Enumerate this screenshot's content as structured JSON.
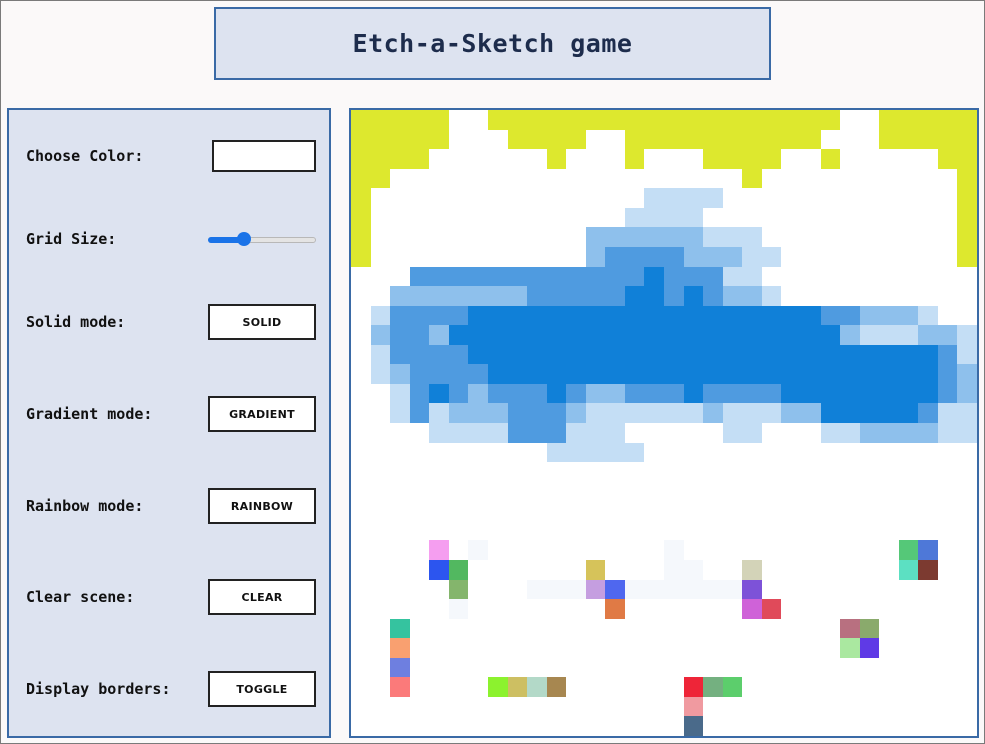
{
  "title": "Etch-a-Sketch game",
  "controls": {
    "choose_color_label": "Choose Color:",
    "current_color": "#ffffff",
    "grid_size_label": "Grid Size:",
    "grid_size_value": 32,
    "grid_size_min": 1,
    "grid_size_max": 100,
    "solid_label": "Solid mode:",
    "solid_button": "SOLID",
    "gradient_label": "Gradient mode:",
    "gradient_button": "GRADIENT",
    "rainbow_label": "Rainbow mode:",
    "rainbow_button": "RAINBOW",
    "clear_label": "Clear scene:",
    "clear_button": "CLEAR",
    "borders_label": "Display borders:",
    "borders_button": "TOGGLE"
  },
  "colors": {
    "panel_bg": "#dde3f0",
    "panel_border": "#3a6aa6",
    "slider_accent": "#1a73e8",
    "yellow": "#dde82e",
    "blue_dark": "#1080d8",
    "blue_mid": "#4f9be0",
    "blue_light": "#8ec0ec",
    "blue_pale": "#c4def5"
  },
  "grid": {
    "size": 32,
    "palette": {
      "Y": "#dde82e",
      "D": "#1080d8",
      "M": "#4f9be0",
      "L": "#8ec0ec",
      "P": "#c4def5",
      "F": "#f5f8fc"
    },
    "rows": [
      "YYYYY..YYYYYYYYYYYYYYYYYY..YYYYY",
      "YYYYY...YYYY..YYYYYYYYYY...YYYYY",
      "YYYY......Y...Y...YYYY..Y.....YY",
      "YY..................Y..........Y",
      "Y..............PPPP............Y",
      "Y.............PPPP.............Y",
      "Y...........LLLLLLPPP..........Y",
      "Y...........LMMMMLLLPP.........Y",
      "...MMMMMMMMMMMMDMMMPP...........",
      "..LLLLLLLMMMMMDDMDMLLP..........",
      ".PMMMMDDDDDDDDDDDDDDDDDDMMLLLP...",
      ".LMMLDDDDDDDDDDDDDDDDDDDDLPPPLLP.",
      ".PMMMMDDDDDDDDDDDDDDDDDDDDDDDDMP.",
      ".PLMMMMDDDDDDDDDDDDDDDDDDDDDDDMLP",
      "..PMDMLMMMDMLLMMMDMMMMDDDDDDDDMLP",
      "..PMPLLLMMMLPPPPPPLPPPLLDDDDDMPPP",
      "....PPPPMMMPPP.....PP...PPLLLLPP.",
      "..........PPPPP.................",
      "................................",
      "................................",
      "................................",
      "................................",
      "......F.........F...............",
      "................FF..............",
      ".........FFFFFFFFFFF............",
      ".....F..........................",
      "................................",
      "................................",
      "................................",
      "................................",
      "................................",
      "................................"
    ],
    "dots": [
      [
        22,
        4,
        "#f59ef0"
      ],
      [
        23,
        4,
        "#2c55ef"
      ],
      [
        23,
        5,
        "#52b860"
      ],
      [
        24,
        5,
        "#84b56c"
      ],
      [
        23,
        12,
        "#d6c35a"
      ],
      [
        24,
        12,
        "#c59ee0"
      ],
      [
        24,
        13,
        "#4f67ef"
      ],
      [
        25,
        13,
        "#e07a45"
      ],
      [
        23,
        20,
        "#d3d3b8"
      ],
      [
        24,
        20,
        "#7d52d8"
      ],
      [
        25,
        20,
        "#cf62d8"
      ],
      [
        25,
        21,
        "#e04a5a"
      ],
      [
        22,
        28,
        "#55c878"
      ],
      [
        22,
        29,
        "#4e78d8"
      ],
      [
        23,
        28,
        "#5ce0c2"
      ],
      [
        23,
        29,
        "#7c3a30"
      ],
      [
        26,
        2,
        "#35c39f"
      ],
      [
        27,
        2,
        "#f9a070"
      ],
      [
        28,
        2,
        "#6e7fe0"
      ],
      [
        29,
        2,
        "#fb7a7a"
      ],
      [
        29,
        7,
        "#8cf22e"
      ],
      [
        29,
        8,
        "#cdbf62"
      ],
      [
        29,
        9,
        "#b3d9c8"
      ],
      [
        29,
        10,
        "#a78750"
      ],
      [
        29,
        17,
        "#ee2538"
      ],
      [
        29,
        18,
        "#74b080"
      ],
      [
        29,
        19,
        "#5cce6c"
      ],
      [
        30,
        17,
        "#f09aa0"
      ],
      [
        31,
        17,
        "#4a6a8a"
      ],
      [
        26,
        25,
        "#b87080"
      ],
      [
        26,
        26,
        "#8aaa6c"
      ],
      [
        27,
        25,
        "#aae8a0"
      ],
      [
        27,
        26,
        "#5f3ae6"
      ]
    ],
    "dots2": [
      [
        32,
        23,
        "#7c8a2e"
      ],
      [
        32,
        24,
        "#cf9a20"
      ],
      [
        33,
        24,
        "#8aa8a8"
      ],
      [
        34,
        24,
        "#c8a0ee"
      ],
      [
        35,
        23,
        "#d08ad8"
      ],
      [
        35,
        24,
        "#6f8a7e"
      ],
      [
        33,
        29,
        "#d4a85a"
      ],
      [
        33,
        30,
        "#5ce8c2"
      ],
      [
        34,
        29,
        "#98b090"
      ],
      [
        35,
        29,
        "#b07ac8"
      ]
    ]
  }
}
